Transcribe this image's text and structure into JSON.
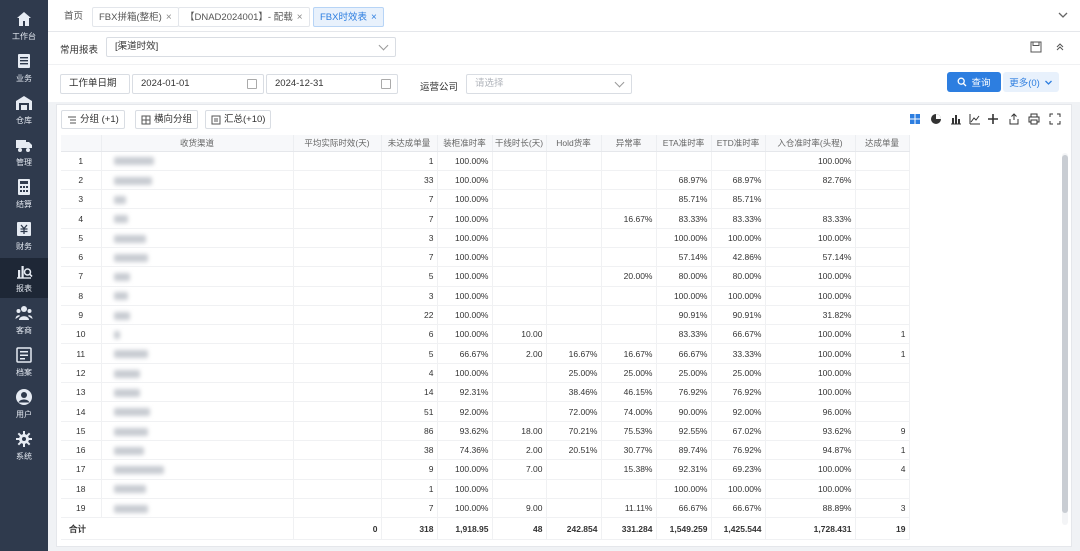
{
  "sidebar": {
    "items": [
      {
        "label": "工作台",
        "icon": "home-icon"
      },
      {
        "label": "业务",
        "icon": "document-icon"
      },
      {
        "label": "仓库",
        "icon": "warehouse-icon"
      },
      {
        "label": "管理",
        "icon": "truck-icon"
      },
      {
        "label": "结算",
        "icon": "calculator-icon"
      },
      {
        "label": "财务",
        "icon": "finance-icon"
      },
      {
        "label": "报表",
        "icon": "report-icon"
      },
      {
        "label": "客商",
        "icon": "users-icon"
      },
      {
        "label": "档案",
        "icon": "archive-icon"
      },
      {
        "label": "用户",
        "icon": "user-icon"
      },
      {
        "label": "系统",
        "icon": "gear-icon"
      }
    ],
    "active_index": 6
  },
  "tabs": [
    {
      "label": "首页"
    },
    {
      "label": "FBX拼箱(整柜)",
      "close": "×"
    },
    {
      "label": "【DNAD2024001】- 配载",
      "close": "×"
    },
    {
      "label": "FBX时效表",
      "close": "×"
    }
  ],
  "report": {
    "label": "常用报表",
    "value": "[渠道时效]"
  },
  "filters": {
    "date_label": "工作单日期",
    "date_from": "2024-01-01",
    "date_to": "2024-12-31",
    "carrier_label": "运营公司",
    "carrier_placeholder": "请选择",
    "query_label": "查询",
    "more_label": "更多(0)"
  },
  "toolbar": {
    "group": "分组 (+1)",
    "cross_group": "横向分组",
    "summary": "汇总(+10)"
  },
  "columns": [
    "",
    "收货渠道",
    "平均实际时效(天)",
    "未达成单量",
    "装柜准时率",
    "干线时长(天)",
    "Hold货率",
    "异常率",
    "ETA准时率",
    "ETD准时率",
    "入仓准时率(头程)",
    "达成单量"
  ],
  "rows": [
    {
      "idx": "1",
      "w": 40,
      "avg": "",
      "miss": "1",
      "load": "100.00%",
      "trunk": "",
      "hold": "",
      "abn": "",
      "eta": "",
      "etd": "",
      "inb": "100.00%",
      "hit": ""
    },
    {
      "idx": "2",
      "w": 38,
      "avg": "",
      "miss": "33",
      "load": "100.00%",
      "trunk": "",
      "hold": "",
      "abn": "",
      "eta": "68.97%",
      "etd": "68.97%",
      "inb": "82.76%",
      "hit": ""
    },
    {
      "idx": "3",
      "w": 12,
      "avg": "",
      "miss": "7",
      "load": "100.00%",
      "trunk": "",
      "hold": "",
      "abn": "",
      "eta": "85.71%",
      "etd": "85.71%",
      "inb": "",
      "hit": ""
    },
    {
      "idx": "4",
      "w": 14,
      "avg": "",
      "miss": "7",
      "load": "100.00%",
      "trunk": "",
      "hold": "",
      "abn": "16.67%",
      "eta": "83.33%",
      "etd": "83.33%",
      "inb": "83.33%",
      "hit": ""
    },
    {
      "idx": "5",
      "w": 32,
      "avg": "",
      "miss": "3",
      "load": "100.00%",
      "trunk": "",
      "hold": "",
      "abn": "",
      "eta": "100.00%",
      "etd": "100.00%",
      "inb": "100.00%",
      "hit": ""
    },
    {
      "idx": "6",
      "w": 34,
      "avg": "",
      "miss": "7",
      "load": "100.00%",
      "trunk": "",
      "hold": "",
      "abn": "",
      "eta": "57.14%",
      "etd": "42.86%",
      "inb": "57.14%",
      "hit": ""
    },
    {
      "idx": "7",
      "w": 16,
      "avg": "",
      "miss": "5",
      "load": "100.00%",
      "trunk": "",
      "hold": "",
      "abn": "20.00%",
      "eta": "80.00%",
      "etd": "80.00%",
      "inb": "100.00%",
      "hit": ""
    },
    {
      "idx": "8",
      "w": 14,
      "avg": "",
      "miss": "3",
      "load": "100.00%",
      "trunk": "",
      "hold": "",
      "abn": "",
      "eta": "100.00%",
      "etd": "100.00%",
      "inb": "100.00%",
      "hit": ""
    },
    {
      "idx": "9",
      "w": 16,
      "avg": "",
      "miss": "22",
      "load": "100.00%",
      "trunk": "",
      "hold": "",
      "abn": "",
      "eta": "90.91%",
      "etd": "90.91%",
      "inb": "31.82%",
      "hit": ""
    },
    {
      "idx": "10",
      "w": 6,
      "avg": "",
      "miss": "6",
      "load": "100.00%",
      "trunk": "10.00",
      "hold": "",
      "abn": "",
      "eta": "83.33%",
      "etd": "66.67%",
      "inb": "100.00%",
      "hit": "1"
    },
    {
      "idx": "11",
      "w": 34,
      "avg": "",
      "miss": "5",
      "load": "66.67%",
      "trunk": "2.00",
      "hold": "16.67%",
      "abn": "16.67%",
      "eta": "66.67%",
      "etd": "33.33%",
      "inb": "100.00%",
      "hit": "1"
    },
    {
      "idx": "12",
      "w": 26,
      "avg": "",
      "miss": "4",
      "load": "100.00%",
      "trunk": "",
      "hold": "25.00%",
      "abn": "25.00%",
      "eta": "25.00%",
      "etd": "25.00%",
      "inb": "100.00%",
      "hit": ""
    },
    {
      "idx": "13",
      "w": 26,
      "avg": "",
      "miss": "14",
      "load": "92.31%",
      "trunk": "",
      "hold": "38.46%",
      "abn": "46.15%",
      "eta": "76.92%",
      "etd": "76.92%",
      "inb": "100.00%",
      "hit": ""
    },
    {
      "idx": "14",
      "w": 36,
      "avg": "",
      "miss": "51",
      "load": "92.00%",
      "trunk": "",
      "hold": "72.00%",
      "abn": "74.00%",
      "eta": "90.00%",
      "etd": "92.00%",
      "inb": "96.00%",
      "hit": ""
    },
    {
      "idx": "15",
      "w": 34,
      "avg": "",
      "miss": "86",
      "load": "93.62%",
      "trunk": "18.00",
      "hold": "70.21%",
      "abn": "75.53%",
      "eta": "92.55%",
      "etd": "67.02%",
      "inb": "93.62%",
      "hit": "9"
    },
    {
      "idx": "16",
      "w": 30,
      "avg": "",
      "miss": "38",
      "load": "74.36%",
      "trunk": "2.00",
      "hold": "20.51%",
      "abn": "30.77%",
      "eta": "89.74%",
      "etd": "76.92%",
      "inb": "94.87%",
      "hit": "1"
    },
    {
      "idx": "17",
      "w": 50,
      "avg": "",
      "miss": "9",
      "load": "100.00%",
      "trunk": "7.00",
      "hold": "",
      "abn": "15.38%",
      "eta": "92.31%",
      "etd": "69.23%",
      "inb": "100.00%",
      "hit": "4"
    },
    {
      "idx": "18",
      "w": 32,
      "avg": "",
      "miss": "1",
      "load": "100.00%",
      "trunk": "",
      "hold": "",
      "abn": "",
      "eta": "100.00%",
      "etd": "100.00%",
      "inb": "100.00%",
      "hit": ""
    },
    {
      "idx": "19",
      "w": 34,
      "avg": "",
      "miss": "7",
      "load": "100.00%",
      "trunk": "9.00",
      "hold": "",
      "abn": "11.11%",
      "eta": "66.67%",
      "etd": "66.67%",
      "inb": "88.89%",
      "hit": "3"
    }
  ],
  "totals": {
    "label": "合计",
    "avg": "0",
    "miss": "318",
    "load": "1,918.95",
    "trunk": "48",
    "hold": "242.854",
    "abn": "331.284",
    "eta": "1,549.259",
    "etd": "1,425.544",
    "inb": "1,728.431",
    "hit": "19"
  },
  "colors": {
    "sidebar_bg": "#2f3a4d",
    "sidebar_active": "#1e2736",
    "accent": "#2d7ee0"
  }
}
